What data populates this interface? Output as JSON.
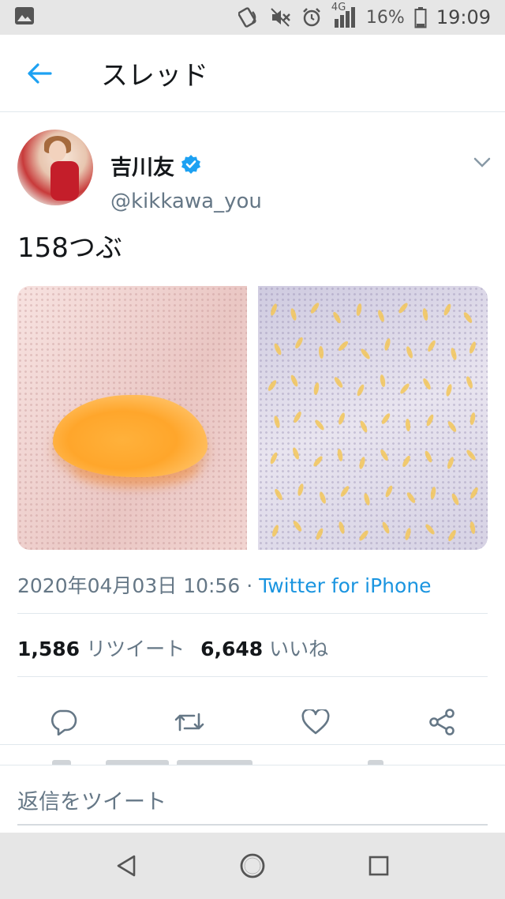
{
  "status_bar": {
    "network": "4G",
    "battery_percent": "16%",
    "time": "19:09",
    "icons": [
      "gallery-icon",
      "nfc-icon",
      "mute-icon",
      "alarm-icon",
      "signal-icon",
      "battery-icon"
    ]
  },
  "header": {
    "title": "スレッド",
    "back_icon": "arrow-left-icon"
  },
  "tweet": {
    "author": {
      "display_name": "吉川友",
      "handle": "@kikkawa_you",
      "verified": true
    },
    "text": "158つぶ",
    "media": [
      {
        "description": "orange-segment-photo"
      },
      {
        "description": "orange-pulp-grains-photo"
      }
    ],
    "timestamp": "2020年04月03日 10:56",
    "separator": " · ",
    "source": "Twitter for iPhone",
    "stats": {
      "retweets_count": "1,586",
      "retweets_label": "リツイート",
      "likes_count": "6,648",
      "likes_label": "いいね"
    },
    "actions": [
      "reply-icon",
      "retweet-icon",
      "like-icon",
      "share-icon"
    ]
  },
  "reply_box": {
    "placeholder": "返信をツイート"
  },
  "nav_bar": {
    "buttons": [
      "back-triangle-icon",
      "home-circle-icon",
      "recents-square-icon"
    ]
  },
  "colors": {
    "accent": "#1b95e0",
    "secondary_text": "#657786",
    "divider": "#e1e8ed",
    "verified": "#1da1f2"
  }
}
